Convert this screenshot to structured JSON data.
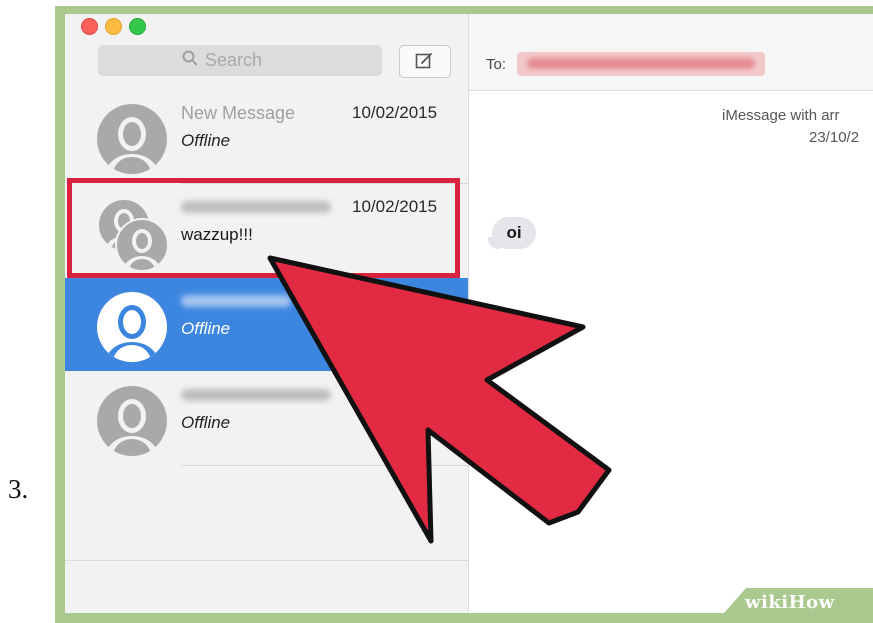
{
  "step_number": "3.",
  "search": {
    "placeholder": "Search"
  },
  "conversations": [
    {
      "name": "New Message",
      "date": "10/02/2015",
      "preview": "Offline"
    },
    {
      "name": "",
      "date": "10/02/2015",
      "preview": "wazzup!!!"
    },
    {
      "name": "",
      "date": "",
      "preview": "Offline"
    },
    {
      "name": "",
      "date": "",
      "preview": "Offline"
    }
  ],
  "header": {
    "to_label": "To:"
  },
  "chat": {
    "imessage_with": "iMessage with arr",
    "date": "23/10/2",
    "bubble_text": "oi"
  },
  "watermark": "wikiHow",
  "colors": {
    "selection": "#3d86e0",
    "highlight_border": "#d9223d",
    "arrow": "#e22a42",
    "frame": "#a9c98f"
  },
  "icons": [
    "search-icon",
    "compose-icon",
    "avatar-icon",
    "group-avatar-icon",
    "pointer-arrow-icon"
  ]
}
